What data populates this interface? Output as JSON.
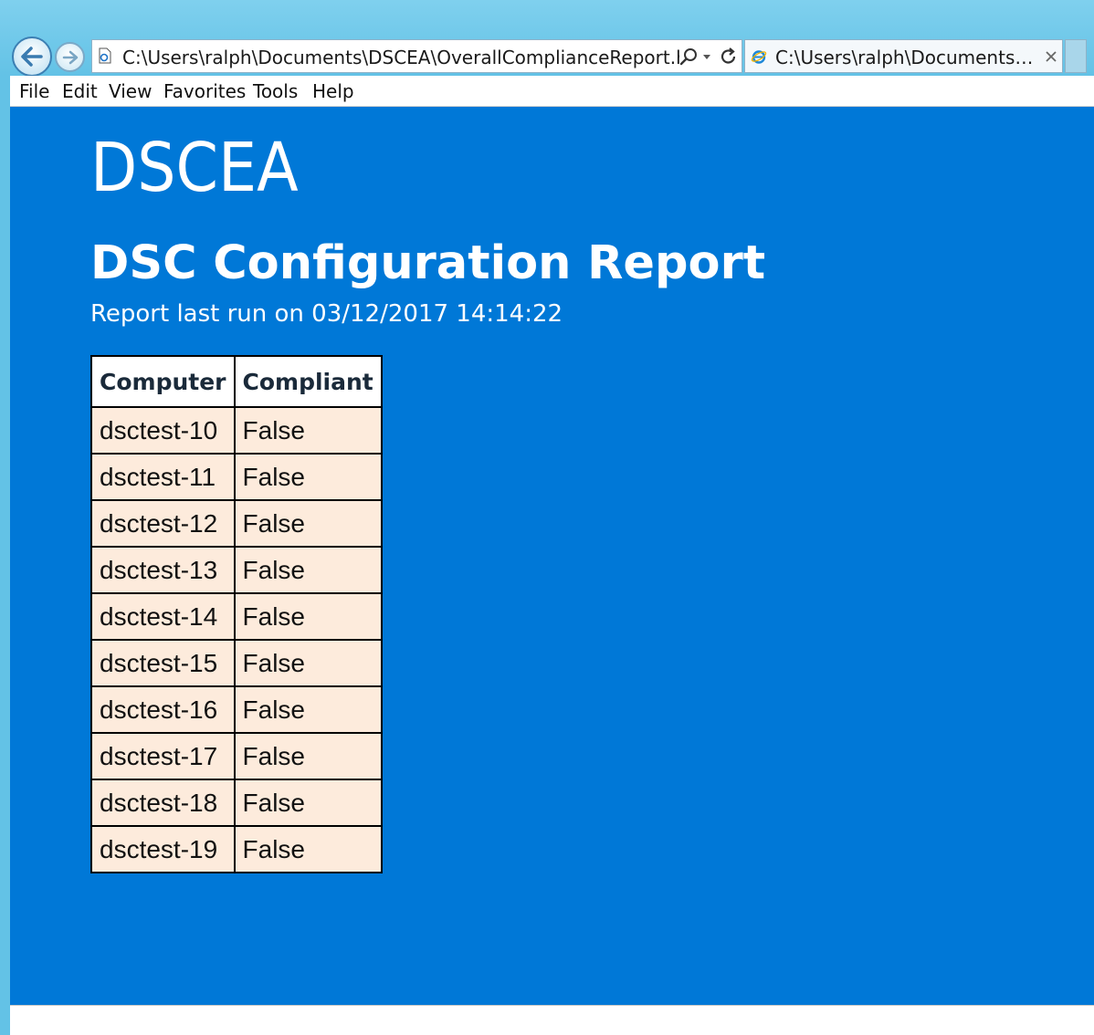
{
  "browser": {
    "address": "C:\\Users\\ralph\\Documents\\DSCEA\\OverallComplianceReport.htm",
    "tab_title": "C:\\Users\\ralph\\Documents\\D...",
    "icons": {
      "back": "back-arrow-icon",
      "forward": "forward-arrow-icon",
      "page": "page-icon",
      "search": "search-icon",
      "dropdown": "chevron-down-icon",
      "refresh": "refresh-icon",
      "tab_favicon": "ie-logo-icon",
      "tab_close": "close-icon"
    }
  },
  "menu": {
    "items": [
      "File",
      "Edit",
      "View",
      "Favorites",
      "Tools",
      "Help"
    ]
  },
  "page": {
    "logo_text": "DSCEA",
    "title": "DSC Configuration Report",
    "subtitle": "Report last run on 03/12/2017 14:14:22",
    "background_color": "#0078d7",
    "table": {
      "headers": [
        "Computer",
        "Compliant"
      ],
      "rows": [
        [
          "dsctest-10",
          "False"
        ],
        [
          "dsctest-11",
          "False"
        ],
        [
          "dsctest-12",
          "False"
        ],
        [
          "dsctest-13",
          "False"
        ],
        [
          "dsctest-14",
          "False"
        ],
        [
          "dsctest-15",
          "False"
        ],
        [
          "dsctest-16",
          "False"
        ],
        [
          "dsctest-17",
          "False"
        ],
        [
          "dsctest-18",
          "False"
        ],
        [
          "dsctest-19",
          "False"
        ]
      ],
      "row_color": "#fdebdc"
    }
  }
}
